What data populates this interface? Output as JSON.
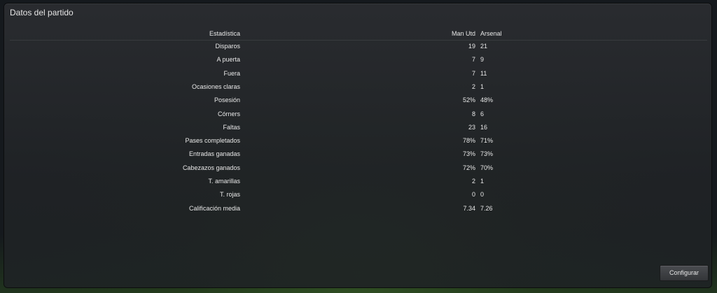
{
  "panel": {
    "title": "Datos del partido"
  },
  "table": {
    "header": {
      "label": "Estadística",
      "team1": "Man Utd",
      "team2": "Arsenal"
    },
    "rows": [
      {
        "label": "Disparos",
        "v1": "19",
        "v2": "21"
      },
      {
        "label": "A puerta",
        "v1": "7",
        "v2": "9"
      },
      {
        "label": "Fuera",
        "v1": "7",
        "v2": "11"
      },
      {
        "label": "Ocasiones claras",
        "v1": "2",
        "v2": "1"
      },
      {
        "label": "Posesión",
        "v1": "52%",
        "v2": "48%"
      },
      {
        "label": "Córners",
        "v1": "8",
        "v2": "6"
      },
      {
        "label": "Faltas",
        "v1": "23",
        "v2": "16"
      },
      {
        "label": "Pases completados",
        "v1": "78%",
        "v2": "71%"
      },
      {
        "label": "Entradas ganadas",
        "v1": "73%",
        "v2": "73%"
      },
      {
        "label": "Cabezazos ganados",
        "v1": "72%",
        "v2": "70%"
      },
      {
        "label": "T. amarillas",
        "v1": "2",
        "v2": "1"
      },
      {
        "label": "T. rojas",
        "v1": "0",
        "v2": "0"
      },
      {
        "label": "Calificación media",
        "v1": "7.34",
        "v2": "7.26"
      }
    ]
  },
  "actions": {
    "configure_label": "Configurar"
  }
}
